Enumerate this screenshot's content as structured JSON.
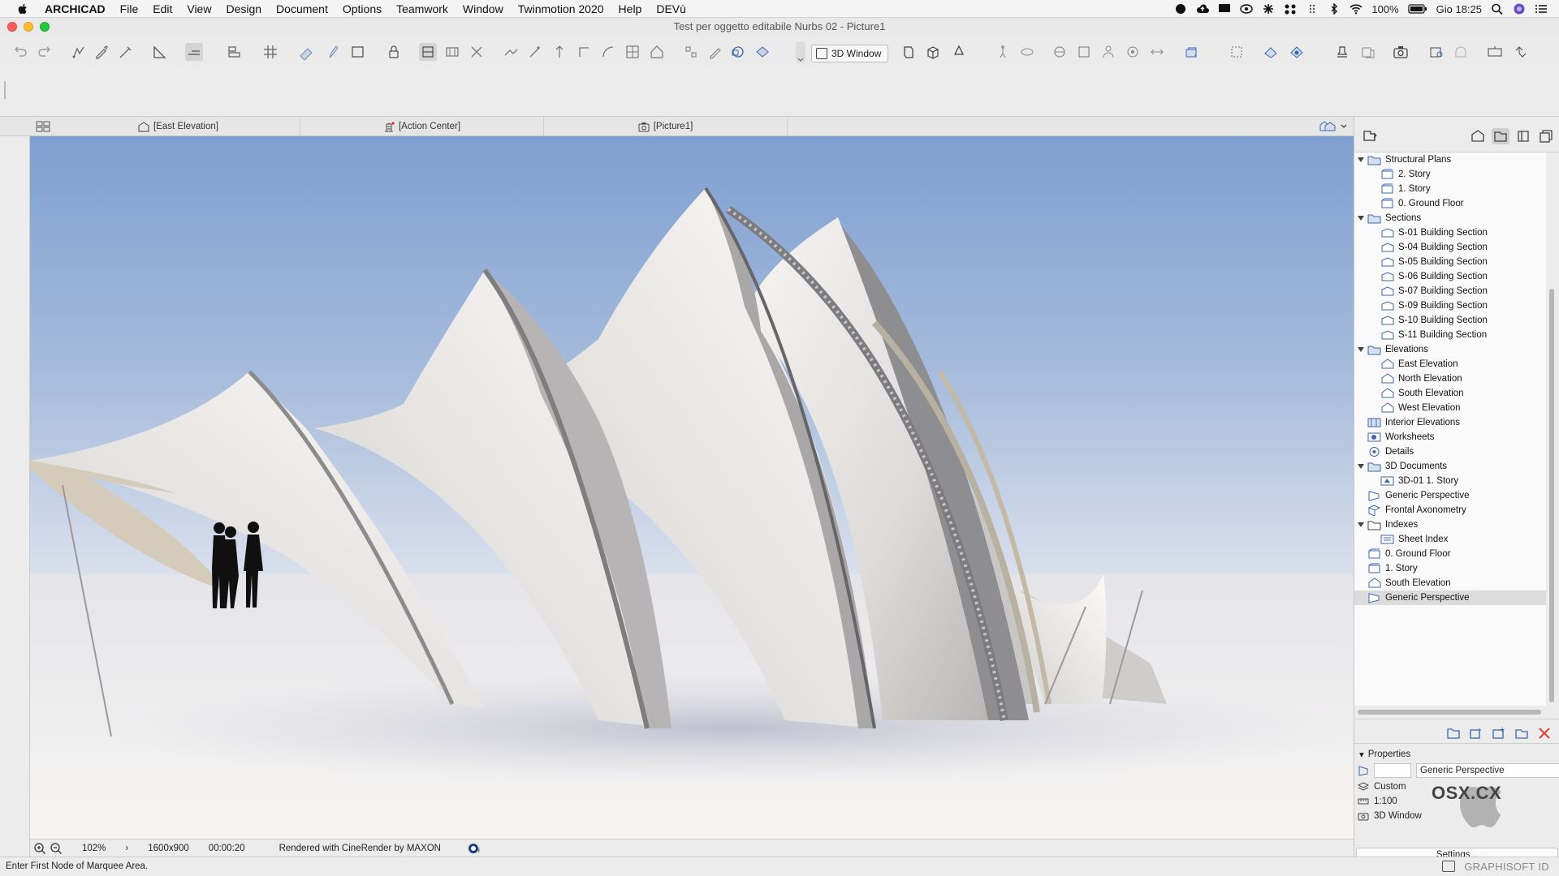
{
  "menubar": {
    "app": "ARCHICAD",
    "items": [
      "File",
      "Edit",
      "View",
      "Design",
      "Document",
      "Options",
      "Teamwork",
      "Window",
      "Twinmotion 2020",
      "Help",
      "DEVù"
    ],
    "battery": "100%",
    "clock": "Gio 18:25"
  },
  "window": {
    "title": "Test per oggetto editabile Nurbs 02 - Picture1"
  },
  "toolbar": {
    "window_3d_label": "3D Window"
  },
  "tabs": [
    {
      "label": "[East Elevation]",
      "icon": "elevation-icon"
    },
    {
      "label": "[Action Center]",
      "icon": "action-center-icon"
    },
    {
      "label": "[Picture1]",
      "icon": "camera-icon"
    }
  ],
  "navigator": {
    "tree": [
      {
        "label": "Structural Plans",
        "level": 0,
        "expanded": true,
        "icon": "folder-plans"
      },
      {
        "label": "2. Story",
        "level": 1,
        "icon": "story"
      },
      {
        "label": "1. Story",
        "level": 1,
        "icon": "story"
      },
      {
        "label": "0. Ground Floor",
        "level": 1,
        "icon": "story"
      },
      {
        "label": "Sections",
        "level": 0,
        "expanded": true,
        "icon": "folder-sections"
      },
      {
        "label": "S-01 Building Section",
        "level": 1,
        "icon": "section"
      },
      {
        "label": "S-04 Building Section",
        "level": 1,
        "icon": "section"
      },
      {
        "label": "S-05 Building Section",
        "level": 1,
        "icon": "section"
      },
      {
        "label": "S-06 Building Section",
        "level": 1,
        "icon": "section"
      },
      {
        "label": "S-07 Building Section",
        "level": 1,
        "icon": "section"
      },
      {
        "label": "S-09 Building Section",
        "level": 1,
        "icon": "section"
      },
      {
        "label": "S-10 Building Section",
        "level": 1,
        "icon": "section"
      },
      {
        "label": "S-11 Building Section",
        "level": 1,
        "icon": "section"
      },
      {
        "label": "Elevations",
        "level": 0,
        "expanded": true,
        "icon": "folder-elevations"
      },
      {
        "label": "East Elevation",
        "level": 1,
        "icon": "elevation"
      },
      {
        "label": "North Elevation",
        "level": 1,
        "icon": "elevation"
      },
      {
        "label": "South Elevation",
        "level": 1,
        "icon": "elevation"
      },
      {
        "label": "West Elevation",
        "level": 1,
        "icon": "elevation"
      },
      {
        "label": "Interior Elevations",
        "level": 0,
        "icon": "interior-elevations"
      },
      {
        "label": "Worksheets",
        "level": 0,
        "icon": "worksheets"
      },
      {
        "label": "Details",
        "level": 0,
        "icon": "details"
      },
      {
        "label": "3D Documents",
        "level": 0,
        "expanded": true,
        "icon": "folder-3d-documents"
      },
      {
        "label": "3D-01 1. Story",
        "level": 1,
        "icon": "3d-document"
      },
      {
        "label": "Generic Perspective",
        "level": 0,
        "icon": "perspective"
      },
      {
        "label": "Frontal Axonometry",
        "level": 0,
        "icon": "axonometry"
      },
      {
        "label": "Indexes",
        "level": 0,
        "expanded": true,
        "icon": "folder"
      },
      {
        "label": "Sheet Index",
        "level": 1,
        "icon": "index"
      },
      {
        "label": "0. Ground Floor",
        "level": 0,
        "icon": "story"
      },
      {
        "label": "1. Story",
        "level": 0,
        "icon": "story"
      },
      {
        "label": "South Elevation",
        "level": 0,
        "icon": "elevation"
      },
      {
        "label": "Generic Perspective",
        "level": 0,
        "icon": "perspective",
        "selected": true
      }
    ],
    "properties": {
      "header": "Properties",
      "id_value": "",
      "name_value": "Generic Perspective",
      "layer": "Custom",
      "scale": "1:100",
      "window": "3D Window",
      "settings_label": "Settings..."
    },
    "watermark": "OSX.CX"
  },
  "viewport_status": {
    "zoom": "102%",
    "resolution": "1600x900",
    "time": "00:00:20",
    "renderer": "Rendered with CineRender by MAXON"
  },
  "status_bar": {
    "hint": "Enter First Node of Marquee Area.",
    "brand": "GRAPHISOFT ID"
  },
  "colors": {
    "sky_top": "#7d9fd2",
    "sky_bottom": "#d6e0ee",
    "ground": "#efeef0",
    "canvas": "#f4f3f0",
    "close_red": "#e53a32",
    "selection": "#dcdcdc"
  }
}
